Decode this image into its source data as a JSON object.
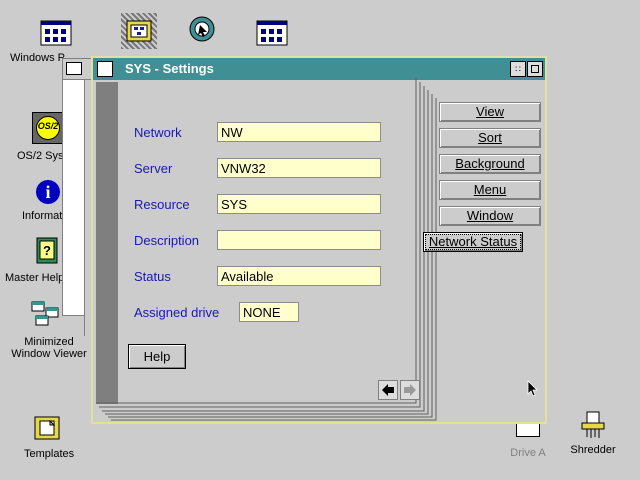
{
  "desktop": {
    "icons": {
      "windows_p": "Windows P",
      "os2_system": "OS/2 Sys",
      "information": "Informat",
      "master_help": "Master Help",
      "minimized_viewer_line1": "Minimized",
      "minimized_viewer_line2": "Window Viewer",
      "templates": "Templates",
      "drive_a": "Drive A",
      "shredder": "Shredder",
      "os2_badge": "OS/2"
    }
  },
  "window": {
    "title": "SYS - Settings",
    "fields": [
      {
        "label": "Network",
        "value": "NW"
      },
      {
        "label": "Server",
        "value": "VNW32"
      },
      {
        "label": "Resource",
        "value": "SYS"
      },
      {
        "label": "Description",
        "value": ""
      },
      {
        "label": "Status",
        "value": "Available"
      },
      {
        "label": "Assigned drive",
        "value": "NONE"
      }
    ],
    "help_button": "Help",
    "tabs": [
      "View",
      "Sort",
      "Background",
      "Menu",
      "Window",
      "Network Status"
    ],
    "selected_tab": "Network Status"
  },
  "colors": {
    "titlebar": "#3f8f94",
    "field_bg": "#ffffcc",
    "label_text": "#1a1aa8",
    "desktop": "#cccccc"
  }
}
